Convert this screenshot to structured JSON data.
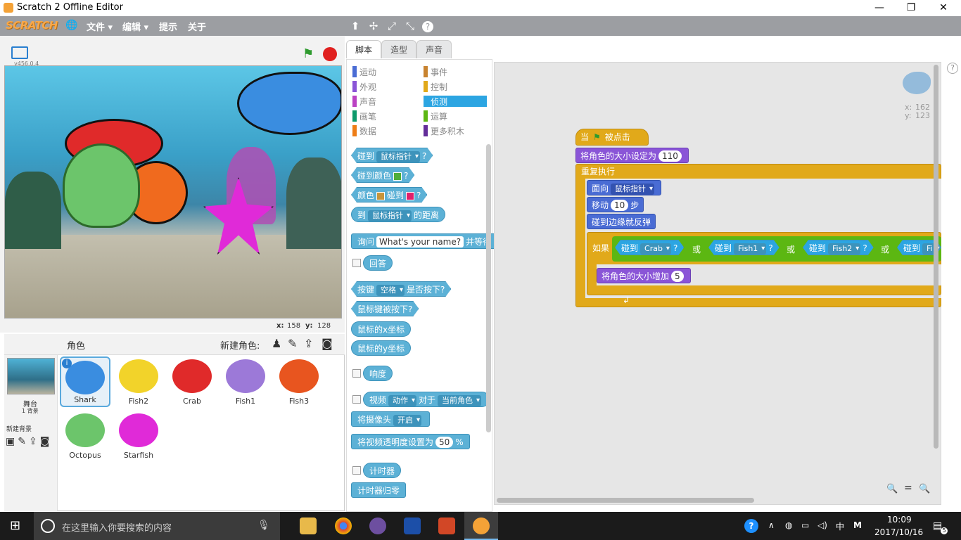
{
  "window": {
    "title": "Scratch 2 Offline Editor",
    "min": "—",
    "max": "❐",
    "close": "✕"
  },
  "menubar": {
    "logo": "SCRATCH",
    "globe": "🌐",
    "file": "文件",
    "edit": "编辑",
    "tips": "提示",
    "about": "关于",
    "tools": [
      "⬆",
      "✢",
      "⤢",
      "⤡",
      "?"
    ]
  },
  "stage": {
    "version": "v456.0.4",
    "x_label": "x:",
    "x_value": "158",
    "y_label": "y:",
    "y_value": "128"
  },
  "sprites": {
    "header": "角色",
    "new_sprite": "新建角色:",
    "stage_label": "舞台",
    "stage_count": "1 背景",
    "new_backdrop": "新建背景",
    "items": [
      {
        "name": "Shark",
        "color": "#3a8de0"
      },
      {
        "name": "Fish2",
        "color": "#f2d32a"
      },
      {
        "name": "Crab",
        "color": "#e02a2a"
      },
      {
        "name": "Fish1",
        "color": "#9c79d8"
      },
      {
        "name": "Fish3",
        "color": "#e8551f"
      },
      {
        "name": "Octopus",
        "color": "#6cc56b"
      },
      {
        "name": "Starfish",
        "color": "#e02ad8"
      }
    ]
  },
  "tabs": [
    "脚本",
    "造型",
    "声音"
  ],
  "categories": {
    "left": [
      {
        "label": "运动",
        "color": "#4a6cd4"
      },
      {
        "label": "外观",
        "color": "#8a55d7"
      },
      {
        "label": "声音",
        "color": "#bb42c3"
      },
      {
        "label": "画笔",
        "color": "#0e9a6c"
      },
      {
        "label": "数据",
        "color": "#ee7d16"
      }
    ],
    "right": [
      {
        "label": "事件",
        "color": "#c88330"
      },
      {
        "label": "控制",
        "color": "#e1a91a"
      },
      {
        "label": "侦测",
        "color": "#2ca5e2"
      },
      {
        "label": "运算",
        "color": "#5cb712"
      },
      {
        "label": "更多积木",
        "color": "#632d99"
      }
    ]
  },
  "palette": {
    "touching": "碰到",
    "touching_opt": "鼠标指针",
    "q": "?",
    "touching_color": "碰到颜色",
    "color_word": "颜色",
    "color_touching": "碰到",
    "distance_to": "到",
    "distance_opt": "鼠标指针",
    "distance_suffix": "的距离",
    "ask": "询问",
    "ask_value": "What's your name?",
    "ask_wait": "并等待",
    "answer": "回答",
    "key": "按键",
    "key_opt": "空格",
    "key_pressed": "是否按下?",
    "mouse_down": "鼠标键被按下?",
    "mouse_x": "鼠标的x坐标",
    "mouse_y": "鼠标的y坐标",
    "loudness": "响度",
    "video": "视频",
    "video_opt": "动作",
    "video_on": "对于",
    "video_target": "当前角色",
    "turn_video": "将摄像头",
    "turn_video_opt": "开启",
    "set_transparency": "将视频透明度设置为",
    "transparency_val": "50",
    "percent": "%",
    "timer": "计时器",
    "reset_timer": "计时器归零"
  },
  "script": {
    "sprite_x_label": "x:",
    "sprite_x": "162",
    "sprite_y_label": "y:",
    "sprite_y": "123",
    "when": "当",
    "clicked": "被点击",
    "set_size": "将角色的大小设定为",
    "size_val": "110",
    "forever": "重复执行",
    "point": "面向",
    "point_opt": "鼠标指针",
    "move": "移动",
    "move_val": "10",
    "steps": "步",
    "bounce": "碰到边缘就反弹",
    "if": "如果",
    "touch1": "碰到",
    "touch1_opt": "Crab",
    "or1": "或",
    "touch2": "碰到",
    "touch2_opt": "Fish1",
    "or2": "或",
    "touch3": "碰到",
    "touch3_opt": "Fish2",
    "or3": "或",
    "touch4": "碰到",
    "touch4_opt": "Fi",
    "change_size": "将角色的大小增加",
    "change_val": "5",
    "zoom": [
      "🔍",
      "=",
      "🔍"
    ]
  },
  "taskbar": {
    "search_placeholder": "在这里输入你要搜索的内容",
    "time": "10:09",
    "date": "2017/10/16",
    "ime": "中",
    "notif": "5"
  }
}
